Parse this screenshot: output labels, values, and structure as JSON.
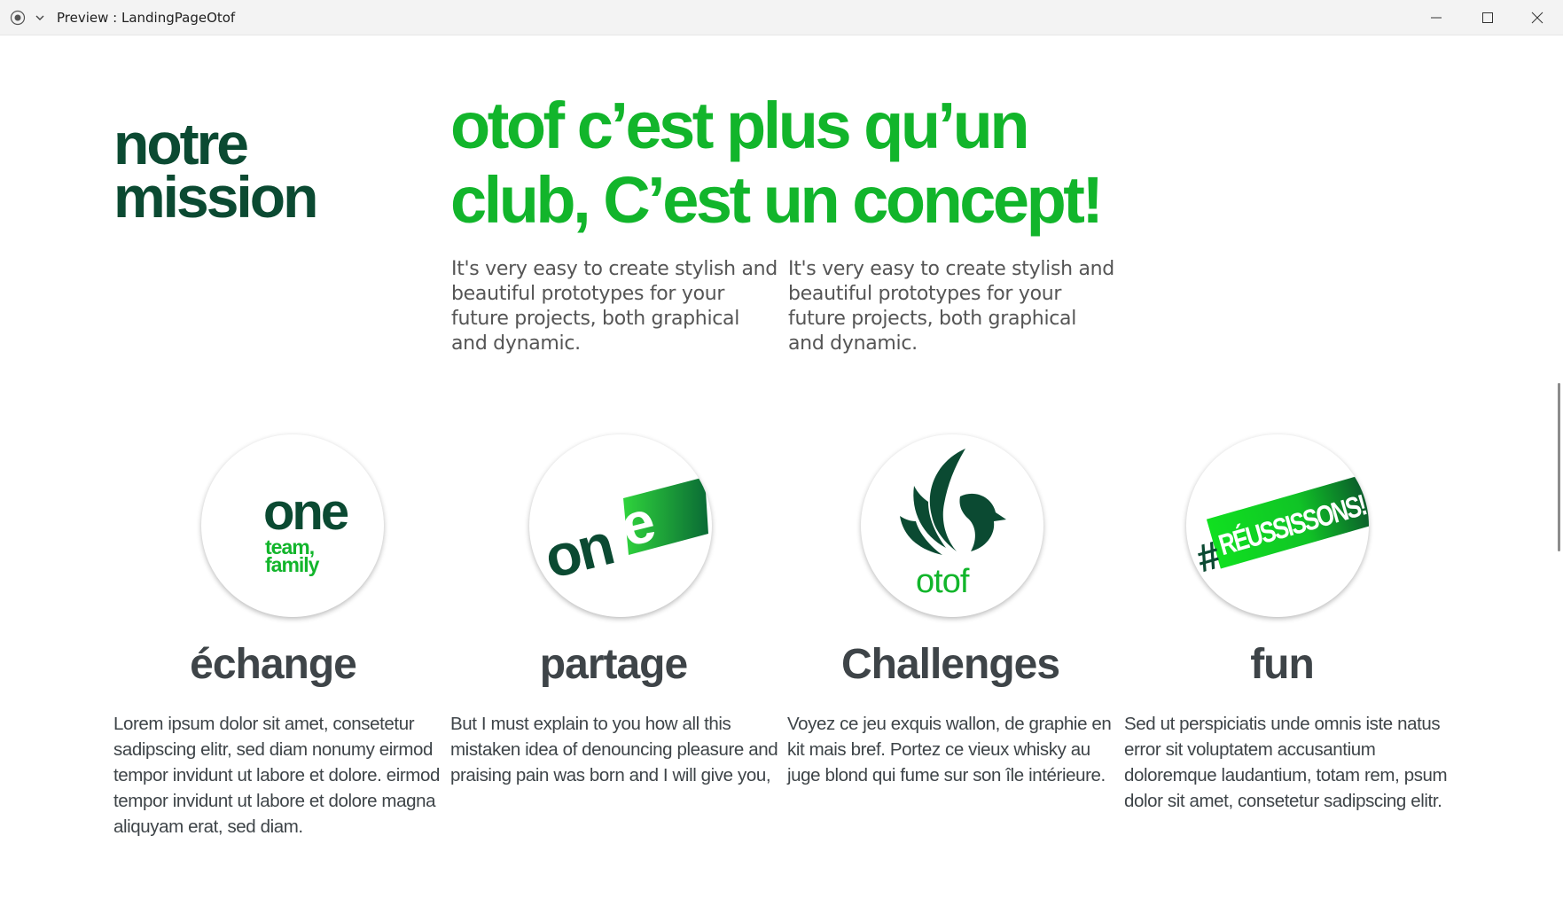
{
  "window": {
    "title": "Preview : LandingPageOtof",
    "icons": {
      "app": "record-icon",
      "dropdown": "chevron-down-icon",
      "minimize": "minimize-icon",
      "maximize": "maximize-icon",
      "close": "close-icon"
    }
  },
  "colors": {
    "dark_green": "#0b4a32",
    "bright_green": "#12b52b",
    "text_gray": "#3e4448",
    "intro_gray": "#555555"
  },
  "mission": {
    "heading_line1": "notre",
    "heading_line2": "mission",
    "title_line1": "otof c’est plus qu’un",
    "title_line2": "club, C’est un concept!",
    "intro_1": "It's very easy to create stylish and beautiful prototypes for your future projects, both graphical and dynamic.",
    "intro_2": "It's very easy to create stylish and beautiful prototypes for your future projects, both graphical and dynamic."
  },
  "features": [
    {
      "title": "échange",
      "text": "Lorem ipsum dolor sit amet, consetetur sadipscing elitr, sed diam nonumy eirmod tempor invidunt ut labore et dolore. eirmod tempor invidunt ut labore et dolore magna aliquyam erat, sed diam.",
      "logo": {
        "word": "one",
        "tagline_1": "team,",
        "tagline_2": "family"
      }
    },
    {
      "title": "partage",
      "text": "But I must explain to you how all this mistaken idea of denouncing pleasure and praising pain was born and I will give you,",
      "logo": {
        "word_dark": "on",
        "word_light": "e"
      }
    },
    {
      "title": "Challenges",
      "text": "Voyez ce jeu exquis wallon, de graphie en kit mais bref. Portez ce vieux whisky au juge blond qui fume sur son île intérieure.",
      "logo": {
        "word": "otof"
      }
    },
    {
      "title": "fun",
      "text": "Sed ut perspiciatis unde omnis iste natus error sit voluptatem accusantium doloremque laudantium, totam rem, psum dolor sit amet, consetetur sadipscing elitr.",
      "logo": {
        "hash": "#",
        "word": "RÉUSSISSONS!"
      }
    }
  ]
}
